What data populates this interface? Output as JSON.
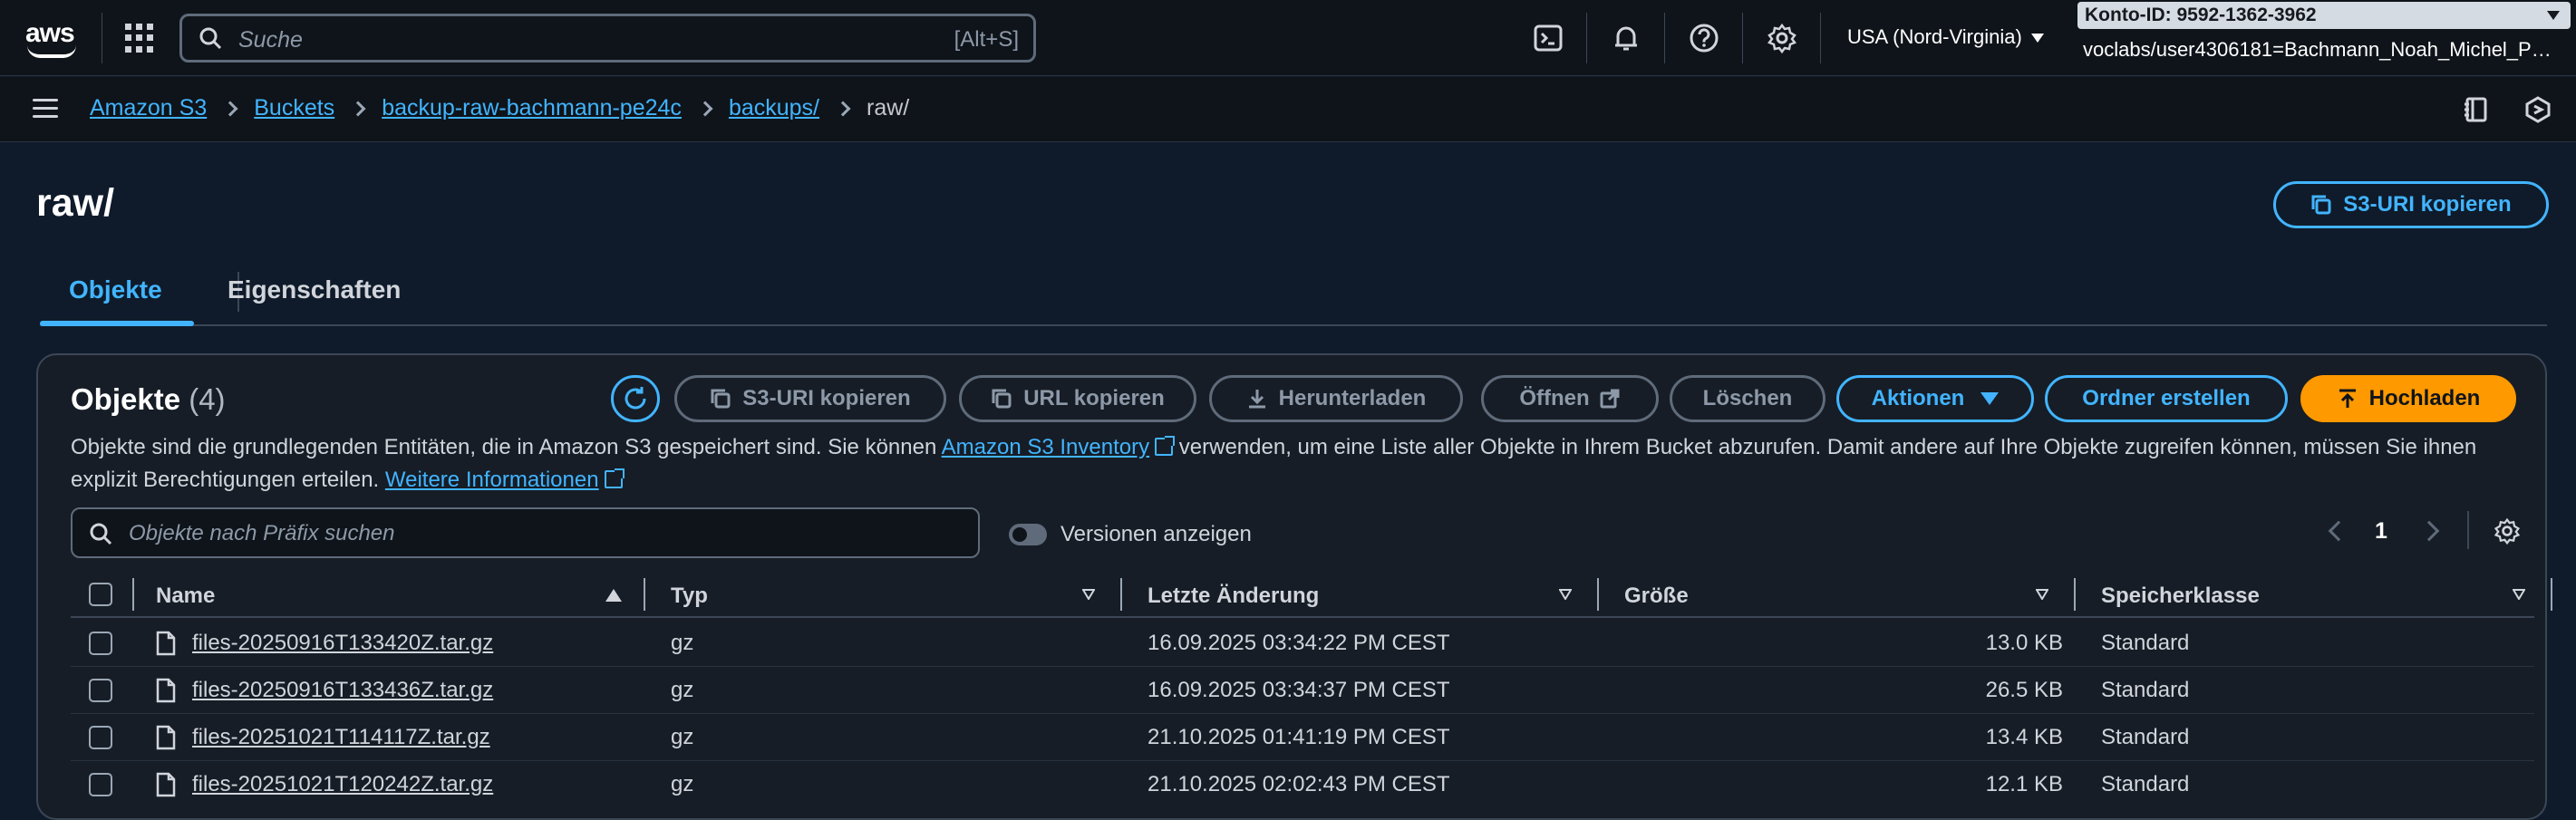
{
  "topnav": {
    "logo_text": "aws",
    "search_placeholder": "Suche",
    "search_shortcut": "[Alt+S]",
    "region": "USA (Nord-Virginia)",
    "account_id": "Konto-ID: 9592-1362-3962",
    "account_user": "voclabs/user4306181=Bachmann_Noah_Michel_PE_..."
  },
  "breadcrumb": {
    "items": [
      "Amazon S3",
      "Buckets",
      "backup-raw-bachmann-pe24c",
      "backups/"
    ],
    "current": "raw/"
  },
  "page": {
    "title": "raw/",
    "copy_uri_label": "S3-URI kopieren"
  },
  "tabs": [
    {
      "label": "Objekte",
      "active": true
    },
    {
      "label": "Eigenschaften",
      "active": false
    }
  ],
  "objects_panel": {
    "title": "Objekte",
    "count": "(4)",
    "actions": {
      "copy_uri": "S3-URI kopieren",
      "copy_url": "URL kopieren",
      "download": "Herunterladen",
      "open": "Öffnen",
      "delete": "Löschen",
      "actions": "Aktionen",
      "create_folder": "Ordner erstellen",
      "upload": "Hochladen"
    },
    "description_part1": "Objekte sind die grundlegenden Entitäten, die in Amazon S3 gespeichert sind. Sie können",
    "description_link1": "Amazon S3 Inventory",
    "description_part2": "verwenden, um eine Liste aller Objekte in Ihrem Bucket abzurufen. Damit andere auf Ihre Objekte zugreifen können, müssen Sie ihnen explizit Berechtigungen erteilen.",
    "description_link2": "Weitere Informationen",
    "filter_placeholder": "Objekte nach Präfix suchen",
    "versions_label": "Versionen anzeigen",
    "page_number": "1"
  },
  "table": {
    "columns": [
      "Name",
      "Typ",
      "Letzte Änderung",
      "Größe",
      "Speicherklasse"
    ],
    "rows": [
      {
        "name": "files-20250916T133420Z.tar.gz",
        "type": "gz",
        "modified": "16.09.2025 03:34:22 PM CEST",
        "size": "13.0 KB",
        "class": "Standard"
      },
      {
        "name": "files-20250916T133436Z.tar.gz",
        "type": "gz",
        "modified": "16.09.2025 03:34:37 PM CEST",
        "size": "26.5 KB",
        "class": "Standard"
      },
      {
        "name": "files-20251021T114117Z.tar.gz",
        "type": "gz",
        "modified": "21.10.2025 01:41:19 PM CEST",
        "size": "13.4 KB",
        "class": "Standard"
      },
      {
        "name": "files-20251021T120242Z.tar.gz",
        "type": "gz",
        "modified": "21.10.2025 02:02:43 PM CEST",
        "size": "12.1 KB",
        "class": "Standard"
      }
    ]
  },
  "colors": {
    "accent": "#42b4ff",
    "upload": "#ff9900",
    "background": "#0f1b2a"
  }
}
